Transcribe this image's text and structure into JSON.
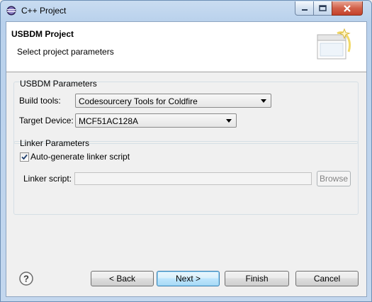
{
  "window": {
    "title": "C++ Project"
  },
  "header": {
    "title": "USBDM Project",
    "description": "Select project parameters"
  },
  "usbdm_group": {
    "title": "USBDM Parameters",
    "build_tools_label": "Build tools:",
    "build_tools_value": "Codesourcery Tools for Coldfire",
    "target_device_label": "Target Device:",
    "target_device_value": "MCF51AC128A"
  },
  "linker_group": {
    "title": "Linker Parameters",
    "auto_generate_label": "Auto-generate linker script",
    "auto_generate_checked": true,
    "linker_script_label": "Linker script:",
    "linker_script_value": "",
    "browse_label": "Browse"
  },
  "footer": {
    "back_label": "< Back",
    "next_label": "Next >",
    "finish_label": "Finish",
    "cancel_label": "Cancel"
  },
  "icons": [
    "eclipse-app-icon",
    "minimize-icon",
    "maximize-icon",
    "close-icon",
    "wizard-banner-icon",
    "help-icon",
    "checkmark-icon"
  ]
}
